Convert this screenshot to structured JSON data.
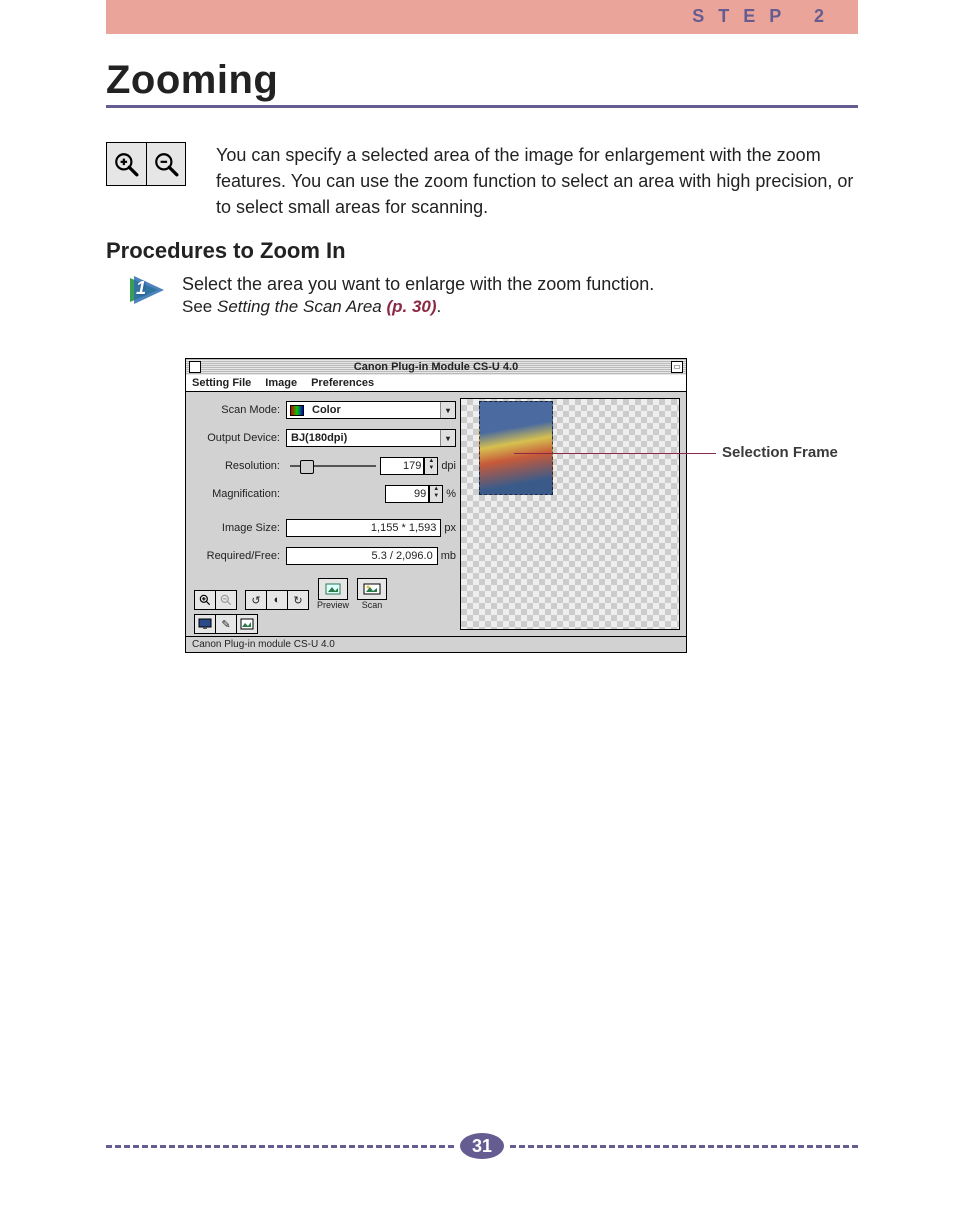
{
  "header": {
    "step_label": "STEP 2",
    "title": "Zooming",
    "intro": "You can specify a selected area of the image for enlargement with the zoom features. You can use the zoom function to select an area with high precision, or to select small areas for scanning."
  },
  "section": {
    "subheading": "Procedures to Zoom In"
  },
  "steps": [
    {
      "number": "1",
      "main": "Select the area you want to enlarge with the zoom function.",
      "sub_prefix": "See ",
      "sub_italic": "Setting the Scan Area ",
      "sub_link": "(p. 30)",
      "sub_suffix": "."
    }
  ],
  "window": {
    "title": "Canon Plug-in Module CS-U 4.0",
    "menu": [
      "Setting File",
      "Image",
      "Preferences"
    ],
    "controls": {
      "scan_mode": {
        "label": "Scan Mode:",
        "value": "Color"
      },
      "output_device": {
        "label": "Output Device:",
        "value": "BJ(180dpi)"
      },
      "resolution": {
        "label": "Resolution:",
        "value": "179",
        "unit": "dpi"
      },
      "magnification": {
        "label": "Magnification:",
        "value": "99",
        "unit": "%"
      },
      "image_size": {
        "label": "Image Size:",
        "value": "1,155 * 1,593",
        "unit": "px"
      },
      "required_free": {
        "label": "Required/Free:",
        "value": "5.3 / 2,096.0",
        "unit": "mb"
      }
    },
    "actions": {
      "preview": "Preview",
      "scan": "Scan"
    },
    "status": "Canon Plug-in module CS-U 4.0"
  },
  "callouts": {
    "selection_frame": "Selection Frame"
  },
  "footer": {
    "page_number": "31"
  }
}
